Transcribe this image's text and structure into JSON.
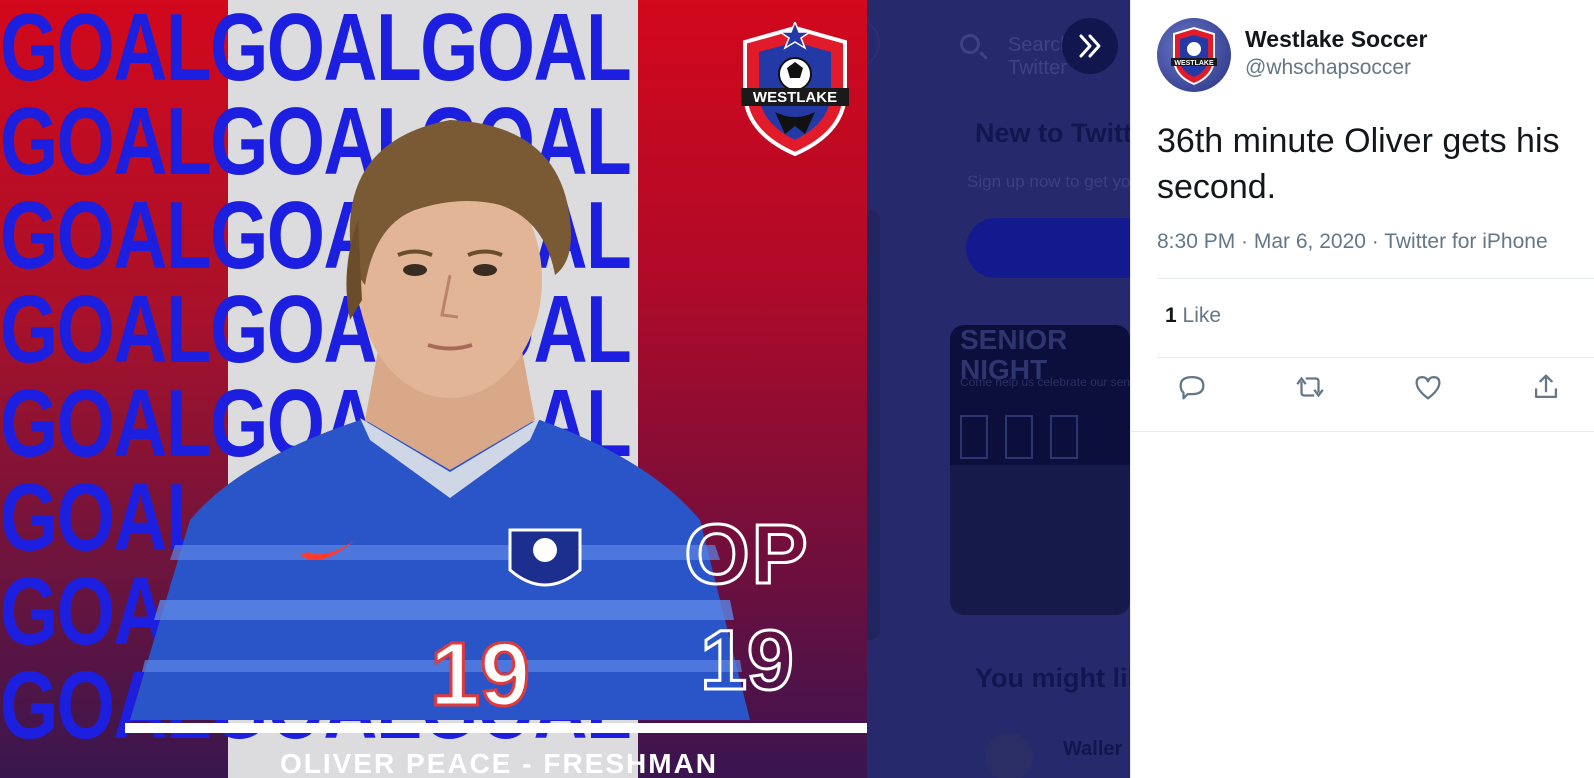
{
  "media": {
    "graphic": {
      "goal_rows": [
        "GOALGOALGOAL",
        "GOALGOALGOAL",
        "GOALGOALGOAL",
        "GOALGOALGOAL",
        "GOALGOALGOAL",
        "GOALGOALGOAL",
        "GOALGOALGOAL",
        "GOALGOALGOAL"
      ],
      "crest_text": "WESTLAKE",
      "jersey_number": "19",
      "initials": "OP",
      "number": "19",
      "caption": "OLIVER PEACE - FRESHMAN",
      "colors": {
        "red": "#d2081c",
        "blue": "#1d1fe0",
        "jersey": "#2a55c9"
      }
    },
    "background_page": {
      "search_placeholder": "Search Twitter",
      "new_heading": "New to Twitter?",
      "new_sub": "Sign up now to get your own",
      "card_title_1": "SENIOR",
      "card_title_2": "NIGHT",
      "card_sub": "Come help us celebrate our seniors",
      "might_like": "You might like",
      "suggested_name": "Waller"
    },
    "next_icon": "double-chevron-right-icon"
  },
  "tweet": {
    "display_name": "Westlake Soccer",
    "handle": "@whschapsoccer",
    "text": "36th minute Oliver gets his second.",
    "time": "8:30 PM",
    "date": "Mar 6, 2020",
    "source": "Twitter for iPhone",
    "meta": "8:30 PM · Mar 6, 2020 · Twitter for iPhone",
    "like_count": "1",
    "like_label": "Like",
    "actions": [
      "reply-icon",
      "retweet-icon",
      "like-icon",
      "share-icon"
    ],
    "accent": "#1da1f2"
  }
}
